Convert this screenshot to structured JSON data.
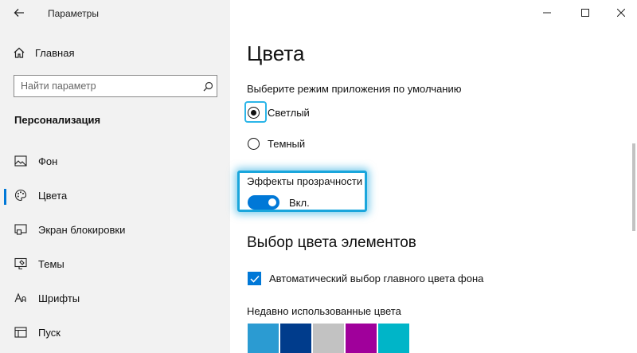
{
  "window": {
    "title": "Параметры",
    "minimize": "minimize",
    "maximize": "maximize",
    "close": "close"
  },
  "sidebar": {
    "home_label": "Главная",
    "search_placeholder": "Найти параметр",
    "section_title": "Персонализация",
    "items": [
      {
        "label": "Фон",
        "icon": "image-icon"
      },
      {
        "label": "Цвета",
        "icon": "palette-icon",
        "selected": true
      },
      {
        "label": "Экран блокировки",
        "icon": "lock-screen-icon"
      },
      {
        "label": "Темы",
        "icon": "themes-icon"
      },
      {
        "label": "Шрифты",
        "icon": "font-icon"
      },
      {
        "label": "Пуск",
        "icon": "start-icon"
      }
    ]
  },
  "main": {
    "title": "Цвета",
    "mode_label": "Выберите режим приложения по умолчанию",
    "mode_options": [
      {
        "label": "Светлый",
        "selected": true
      },
      {
        "label": "Темный",
        "selected": false
      }
    ],
    "transparency_label": "Эффекты прозрачности",
    "transparency_state": "Вкл.",
    "transparency_on": true,
    "accent_heading": "Выбор цвета элементов",
    "auto_accent_label": "Автоматический выбор главного цвета фона",
    "auto_accent_checked": true,
    "recent_colors_label": "Недавно использованные цвета",
    "recent_colors": [
      "#2b9bd2",
      "#003c8c",
      "#c2c2c2",
      "#a0009b",
      "#00b5c8"
    ]
  },
  "colors": {
    "accent": "#0078d7",
    "highlight": "#1aa6dc"
  }
}
